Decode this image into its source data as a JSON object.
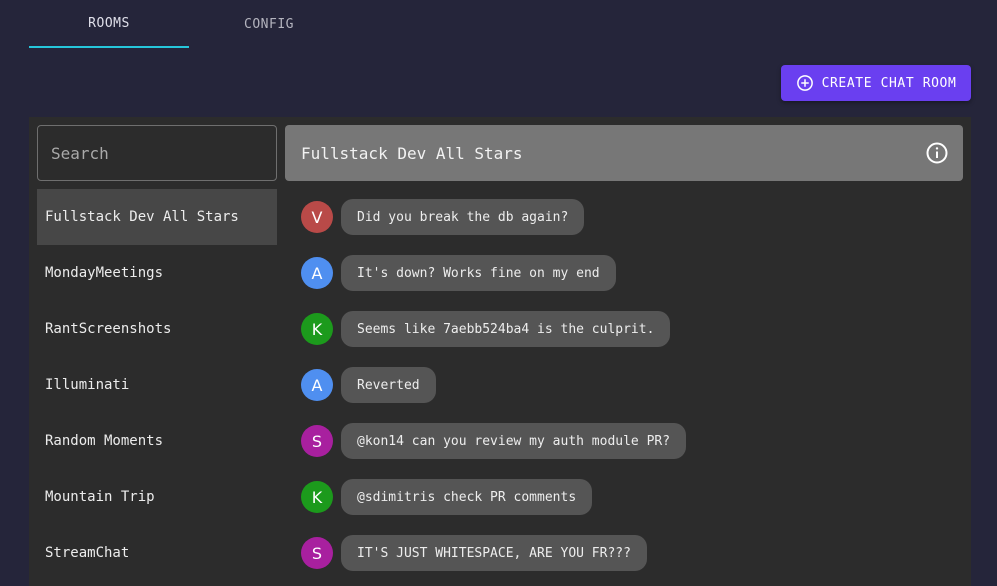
{
  "tabs": [
    {
      "label": "ROOMS",
      "active": true
    },
    {
      "label": "CONFIG",
      "active": false
    }
  ],
  "create_button": {
    "label": "CREATE CHAT ROOM",
    "icon": "plus-circle-icon"
  },
  "search": {
    "placeholder": "Search",
    "value": ""
  },
  "rooms": [
    {
      "name": "Fullstack Dev All Stars",
      "selected": true
    },
    {
      "name": "MondayMeetings",
      "selected": false
    },
    {
      "name": "RantScreenshots",
      "selected": false
    },
    {
      "name": "Illuminati",
      "selected": false
    },
    {
      "name": "Random Moments",
      "selected": false
    },
    {
      "name": "Mountain Trip",
      "selected": false
    },
    {
      "name": "StreamChat",
      "selected": false
    }
  ],
  "chat": {
    "title": "Fullstack Dev All Stars",
    "info_icon": "info-icon",
    "messages": [
      {
        "initial": "V",
        "avatar_color": "#b94a48",
        "text": "Did you break the db again?"
      },
      {
        "initial": "A",
        "avatar_color": "#4f8ff0",
        "text": "It's down? Works fine on my end"
      },
      {
        "initial": "K",
        "avatar_color": "#1c9a1c",
        "text": "Seems like 7aebb524ba4 is the culprit."
      },
      {
        "initial": "A",
        "avatar_color": "#4f8ff0",
        "text": "Reverted"
      },
      {
        "initial": "S",
        "avatar_color": "#a8209f",
        "text": "@kon14 can you review my auth module PR?"
      },
      {
        "initial": "K",
        "avatar_color": "#1c9a1c",
        "text": "@sdimitris check PR comments"
      },
      {
        "initial": "S",
        "avatar_color": "#a8209f",
        "text": "IT'S JUST WHITESPACE, ARE YOU FR???"
      }
    ]
  },
  "colors": {
    "background": "#25253a",
    "accent": "#6a3ff0",
    "tab_indicator": "#26c6da",
    "panel": "#2c2c2c"
  }
}
